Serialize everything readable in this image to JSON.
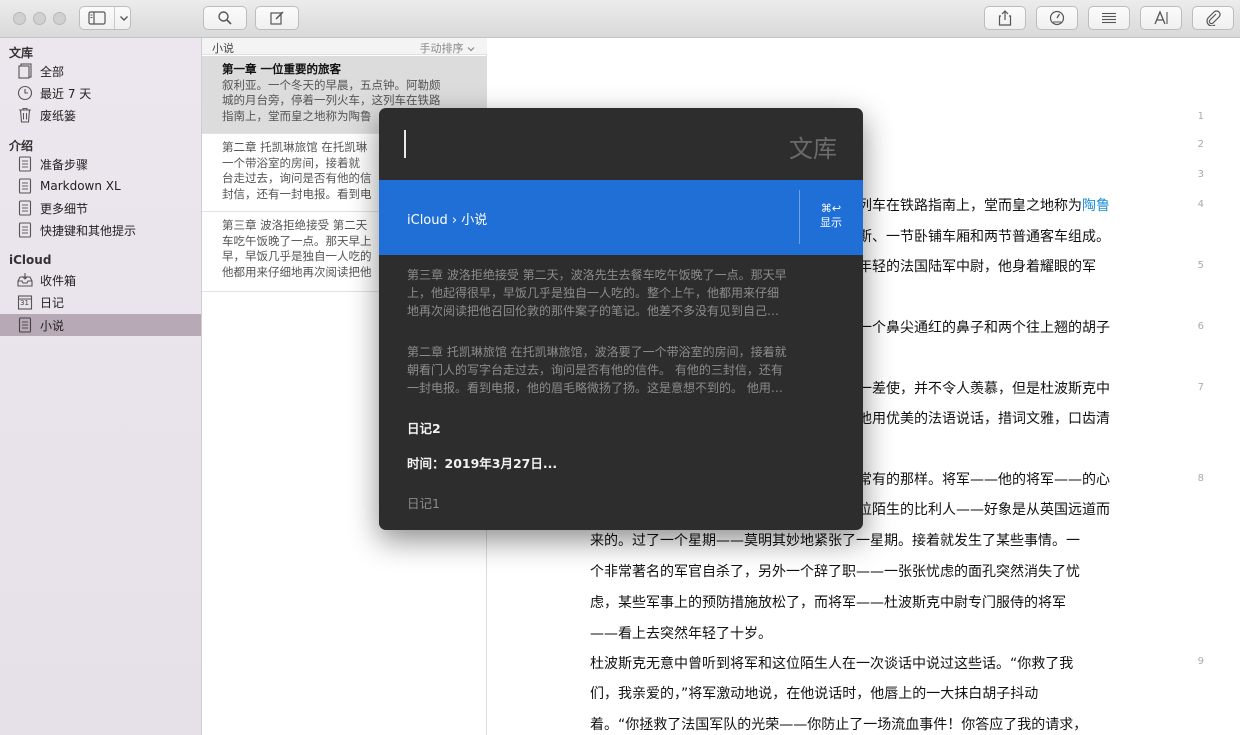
{
  "toolbar": {
    "buttons": [
      "sidebar-toggle-icon",
      "chevron-down-icon",
      "search-icon",
      "compose-icon",
      "share-icon",
      "stats-icon",
      "outline-icon",
      "typography-icon",
      "attachment-icon"
    ]
  },
  "sidebar": {
    "sections": [
      {
        "header": "文库",
        "items": [
          {
            "label": "全部",
            "icon": "notes-stack-icon"
          },
          {
            "label": "最近 7 天",
            "icon": "clock-icon"
          },
          {
            "label": "废纸篓",
            "icon": "trash-icon"
          }
        ]
      },
      {
        "header": "介绍",
        "items": [
          {
            "label": "准备步骤",
            "icon": "document-icon"
          },
          {
            "label": "Markdown XL",
            "icon": "document-icon"
          },
          {
            "label": "更多细节",
            "icon": "document-icon"
          },
          {
            "label": "快捷键和其他提示",
            "icon": "document-icon"
          }
        ]
      },
      {
        "header": "iCloud",
        "items": [
          {
            "label": "收件箱",
            "icon": "inbox-icon"
          },
          {
            "label": "日记",
            "icon": "calendar-icon"
          },
          {
            "label": "小说",
            "icon": "document-icon"
          }
        ]
      }
    ],
    "calendar_day": "31"
  },
  "notelist": {
    "title": "小说",
    "sort": "手动排序",
    "notes": [
      {
        "title": "第一章 一位重要的旅客",
        "lines": [
          "叙利亚。一个冬天的早晨，五点钟。阿勒颇",
          "城的月台旁，停着一列火车，这列车在铁路",
          "指南上，堂而皇之地称为陶鲁"
        ]
      },
      {
        "title": "",
        "lines": [
          "第二章 托凯琳旅馆 在托凯琳",
          "一个带浴室的房间，接着就",
          "台走过去，询问是否有他的信",
          "封信，还有一封电报。看到电"
        ]
      },
      {
        "title": "",
        "lines": [
          "第三章 波洛拒绝接受 第二天",
          "车吃午饭晚了一点。那天早上",
          "早，早饭几乎是独自一人吃的",
          "他都用来仔细地再次阅读把他"
        ]
      }
    ]
  },
  "editor": {
    "line_numbers": [
      "1",
      "2",
      "3",
      "4",
      "5",
      "6",
      "7",
      "8",
      "9"
    ],
    "lines": [
      {
        "text": "列车在铁路指南上，堂而皇之地称为",
        "link": "陶鲁"
      },
      {
        "text": "斯、一节卧铺车厢和两节普通客车组成。"
      },
      {
        "text": "年轻的法国陆军中尉，他身着耀眼的军"
      },
      {
        "text": "一个鼻尖通红的鼻子和两个往上翘的胡子"
      },
      {
        "text": "一差使，并不令人羡慕，但是杜波斯克中"
      },
      {
        "text": "他用优美的法语说话，措词文雅，口齿清"
      },
      {
        "text": "常有的那样。将军——他的将军——的心"
      },
      {
        "text": "位陌生的比利人——好象是从英国远道而"
      },
      {
        "text": "来的。过了一个星期——莫明其妙地紧张了一星期。接着就发生了某些事情。一"
      },
      {
        "text": "个非常著名的军官自杀了，另外一个辞了职——一张张忧虑的面孔突然消失了忧"
      },
      {
        "text": "虑，某些军事上的预防措施放松了，而将军——杜波斯克中尉专门服侍的将军"
      },
      {
        "text": "——看上去突然年轻了十岁。"
      },
      {
        "text": "杜波斯克无意中曾听到将军和这位陌生人在一次谈话中说过这些话。“你救了我"
      },
      {
        "text": "们，我亲爱的，”将军激动地说，在他说话时，他唇上的一大抹白胡子抖动"
      },
      {
        "text": "着。“你拯救了法国军队的光荣——你防止了一场流血事件！你答应了我的请求，"
      }
    ]
  },
  "quick_open": {
    "scope": "文库",
    "selected_path": "iCloud › 小说",
    "shortcut": "⌘↩",
    "shortcut_label": "显示",
    "results": [
      {
        "lines": [
          "第三章 波洛拒绝接受 第二天，波洛先生去餐车吃午饭晚了一点。那天早",
          "上，他起得很早，早饭几乎是独自一人吃的。整个上午，他都用来仔细",
          "地再次阅读把他召回伦敦的那件案子的笔记。他差不多没有见到自己…"
        ]
      },
      {
        "lines": [
          "第二章 托凯琳旅馆 在托凯琳旅馆，波洛要了一个带浴室的房间，接着就",
          "朝看门人的写字台走过去，询问是否有他的信件。 有他的三封信，还有",
          "一封电报。看到电报，他的眉毛略微扬了扬。这是意想不到的。 他用…"
        ]
      }
    ],
    "item_diary2_title": "日记2",
    "item_diary2_sub": "时间：2019年3月27日...",
    "item_diary1_title": "日记1"
  }
}
